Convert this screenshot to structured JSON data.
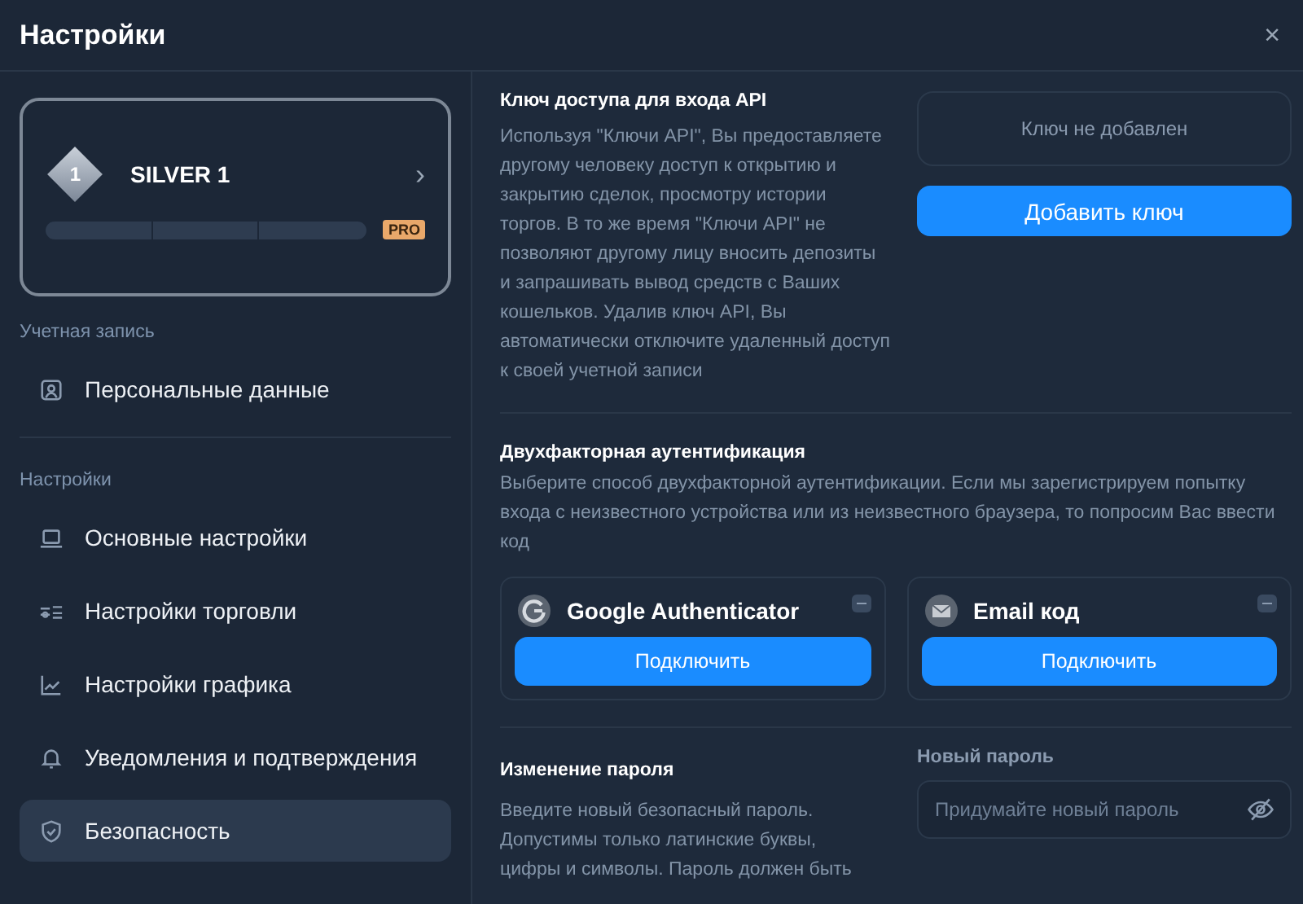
{
  "window": {
    "title": "Настройки",
    "close": "×"
  },
  "sidebar": {
    "rank_card": {
      "badge": "1",
      "title": "SILVER 1",
      "arrow": "›",
      "tag": "PRO"
    },
    "sections": [
      {
        "label": "Учетная запись",
        "items": [
          {
            "label": "Персональные данные",
            "kind": "person",
            "selected": false
          }
        ]
      },
      {
        "label": "Настройки",
        "items": [
          {
            "label": "Основные настройки",
            "kind": "laptop",
            "selected": false
          },
          {
            "label": "Настройки торговли",
            "kind": "trade",
            "selected": false
          },
          {
            "label": "Настройки графика",
            "kind": "chart",
            "selected": false
          },
          {
            "label": "Уведомления и подтверждения",
            "kind": "bell",
            "selected": false
          },
          {
            "label": "Безопасность",
            "kind": "shield",
            "selected": true
          }
        ]
      }
    ]
  },
  "api": {
    "title": "Ключ доступа для входа API",
    "text": "Используя \"Ключи API\", Вы предоставляете другому человеку доступ к открытию и закрытию сделок, просмотру истории торгов. В то же время \"Ключи API\" не позволяют другому лицу вносить депозиты и запрашивать вывод средств с Ваших кошельков. Удалив ключ API, Вы автоматически отключите удаленный доступ к своей учетной записи",
    "status": "Ключ не добавлен",
    "button": "Добавить ключ"
  },
  "two_factor": {
    "title": "Двухфакторная аутентификация",
    "text": "Выберите способ двухфакторной аутентификации. Если мы зарегистрируем попытку входа с неизвестного устройства или из неизвестного браузера, то попросим Вас ввести код",
    "methods": [
      {
        "kind": "authenticator",
        "name": "Google Authenticator",
        "on": false,
        "button": "Подключить"
      },
      {
        "kind": "email",
        "name": "Email код",
        "on": false,
        "button": "Подключить"
      }
    ]
  },
  "password": {
    "title": "Изменение пароля",
    "text": "Введите новый безопасный пароль. Допустимы только латинские буквы, цифры и символы. Пароль должен быть",
    "field_label": "Новый пароль",
    "placeholder": "Придумайте новый пароль"
  }
}
